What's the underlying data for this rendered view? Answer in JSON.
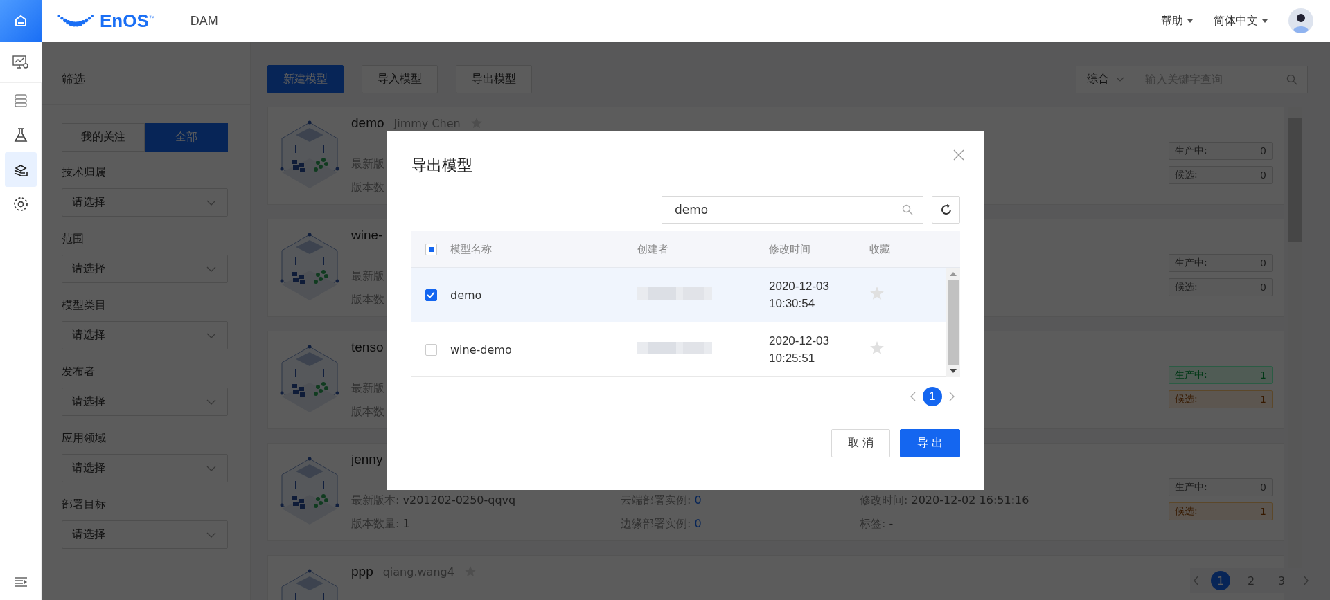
{
  "header": {
    "brand": "EnOS",
    "trademark": "™",
    "app": "DAM",
    "menus": [
      {
        "label": "帮助"
      },
      {
        "label": "简体中文"
      }
    ]
  },
  "rail": [
    {
      "kind": "monitor",
      "selected": false
    },
    {
      "kind": "stack",
      "selected": false
    },
    {
      "kind": "flask",
      "selected": false
    },
    {
      "kind": "hand",
      "selected": true
    },
    {
      "kind": "target",
      "selected": false
    }
  ],
  "filter": {
    "title": "筛选",
    "toggle": [
      {
        "label": "我的关注",
        "selected": false
      },
      {
        "label": "全部",
        "selected": true
      }
    ],
    "fields": [
      {
        "label": "技术归属",
        "placeholder": "请选择"
      },
      {
        "label": "范围",
        "placeholder": "请选择"
      },
      {
        "label": "模型类目",
        "placeholder": "请选择"
      },
      {
        "label": "发布者",
        "placeholder": "请选择"
      },
      {
        "label": "应用领域",
        "placeholder": "请选择"
      },
      {
        "label": "部署目标",
        "placeholder": "请选择"
      }
    ]
  },
  "toolbar": {
    "buttons": [
      {
        "label": "新建模型",
        "kind": "primary"
      },
      {
        "label": "导入模型",
        "kind": "default"
      },
      {
        "label": "导出模型",
        "kind": "default"
      }
    ],
    "sort": "综合",
    "search_placeholder": "输入关键字查询"
  },
  "cards": [
    {
      "name": "demo",
      "author": "Jimmy Chen",
      "favorite": false,
      "rows": [
        [
          {
            "label": "最新版"
          }
        ],
        [
          {
            "label": "版本数"
          }
        ]
      ],
      "badges": [
        {
          "label": "生产中:",
          "value": "0",
          "color": "#5a5a5a"
        },
        {
          "label": "候选:",
          "value": "0",
          "color": "#5a5a5a"
        }
      ]
    },
    {
      "name": "wine-",
      "rows": [
        [
          {
            "label": "最新版"
          }
        ],
        [
          {
            "label": "版本数"
          }
        ]
      ],
      "badges": [
        {
          "label": "生产中:",
          "value": "0",
          "color": "#5a5a5a"
        },
        {
          "label": "候选:",
          "value": "0",
          "color": "#5a5a5a"
        }
      ]
    },
    {
      "name": "tenso",
      "rows": [
        [
          {
            "label": "最新版"
          }
        ],
        [
          {
            "label": "版本数"
          }
        ]
      ],
      "badges": [
        {
          "label": "生产中:",
          "value": "1",
          "color": "#505c55"
        },
        {
          "label": "候选:",
          "value": "1",
          "color": "#5c5650"
        }
      ]
    },
    {
      "name": "jenny",
      "rows": [
        [
          {
            "label": "最新版本: ",
            "value": "v201202-0250-qqvq",
            "kind": "plain"
          },
          {
            "label": "云端部署实例: ",
            "value": "0",
            "kind": "link"
          },
          {
            "label": "修改时间: ",
            "value": "2020-12-02 16:51:16",
            "kind": "plain"
          }
        ],
        [
          {
            "label": "版本数量: ",
            "value": "1",
            "kind": "plain"
          },
          {
            "label": "边缘部署实例: ",
            "value": "0",
            "kind": "link"
          },
          {
            "label": "标签: ",
            "value": "-",
            "kind": "plain"
          }
        ]
      ],
      "badges": [
        {
          "label": "生产中:",
          "value": "0",
          "color": "#5a5a5a"
        },
        {
          "label": "候选:",
          "value": "1",
          "color": "#5c5650"
        }
      ]
    },
    {
      "name": "ppp",
      "author": "qiang.wang4",
      "favorite": false
    }
  ],
  "pagination": [
    {
      "label": "1",
      "selected": true
    },
    {
      "label": "2",
      "selected": false
    },
    {
      "label": "3",
      "selected": false
    }
  ],
  "dialog": {
    "title": "导出模型",
    "search": "demo",
    "columns": [
      "模型名称",
      "创建者",
      "修改时间",
      "收藏"
    ],
    "select_all": {
      "indeterminate": true
    },
    "rows": [
      {
        "name": "demo",
        "time": [
          "2020-12-03",
          "10:30:54"
        ],
        "checked": true,
        "favorite": false
      },
      {
        "name": "wine-demo",
        "time": [
          "2020-12-03",
          "10:25:51"
        ],
        "checked": false,
        "favorite": false
      }
    ],
    "pages": [
      {
        "label": "1",
        "selected": true
      }
    ],
    "cancel": "取 消",
    "confirm": "导 出"
  }
}
